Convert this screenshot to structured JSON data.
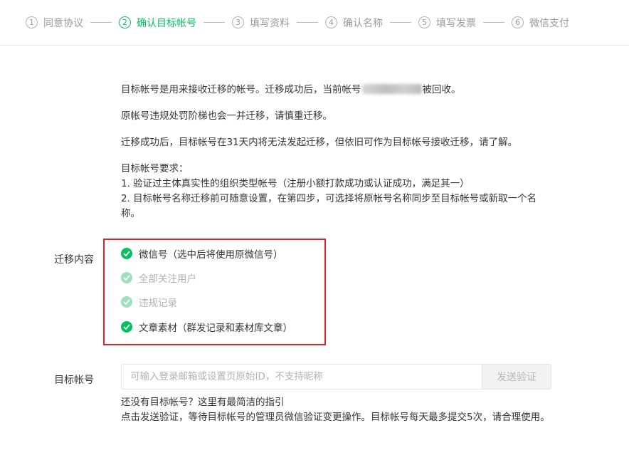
{
  "steps": [
    {
      "num": "1",
      "label": "同意协议",
      "active": false
    },
    {
      "num": "2",
      "label": "确认目标帐号",
      "active": true
    },
    {
      "num": "3",
      "label": "填写资料",
      "active": false
    },
    {
      "num": "4",
      "label": "确认名称",
      "active": false
    },
    {
      "num": "5",
      "label": "填写发票",
      "active": false
    },
    {
      "num": "6",
      "label": "微信支付",
      "active": false
    }
  ],
  "info": {
    "p1_before": "目标帐号是用来接收迁移的帐号。迁移成功后，当前帐号",
    "p1_after": "被回收。",
    "p2": "原帐号违规处罚阶梯也会一并迁移，请慎重迁移。",
    "p3": "迁移成功后，目标帐号在31天内将无法发起迁移，但依旧可作为目标帐号接收迁移，请了解。",
    "req_title": "目标帐号要求：",
    "req_1": "1. 验证过主体真实性的组织类型帐号（注册小额打款成功或认证成功，满足其一）",
    "req_2": "2. 目标帐号名称迁移前可随意设置，在第四步，可选择将原帐号名称同步至目标帐号或新取一个名称。"
  },
  "migrate": {
    "label": "迁移内容",
    "options": [
      {
        "label": "微信号（选中后将使用原微信号）",
        "checked": true,
        "disabled": false
      },
      {
        "label": "全部关注用户",
        "checked": true,
        "disabled": true
      },
      {
        "label": "违规记录",
        "checked": true,
        "disabled": true
      },
      {
        "label": "文章素材（群发记录和素材库文章）",
        "checked": true,
        "disabled": false
      }
    ]
  },
  "target": {
    "label": "目标帐号",
    "placeholder": "可输入登录邮箱或设置页原始ID，不支持昵称",
    "value": "",
    "send_button": "发送验证"
  },
  "help": {
    "line1": "还没有目标帐号？这里有最简洁的指引",
    "line2": "点击发送验证，等待目标帐号的管理员微信验证变更操作。目标帐号每天最多提交5次，请合理使用。"
  },
  "colors": {
    "accent": "#07c160",
    "highlight_box": "#d9262c",
    "disabled_check": "#9ee0bb"
  }
}
